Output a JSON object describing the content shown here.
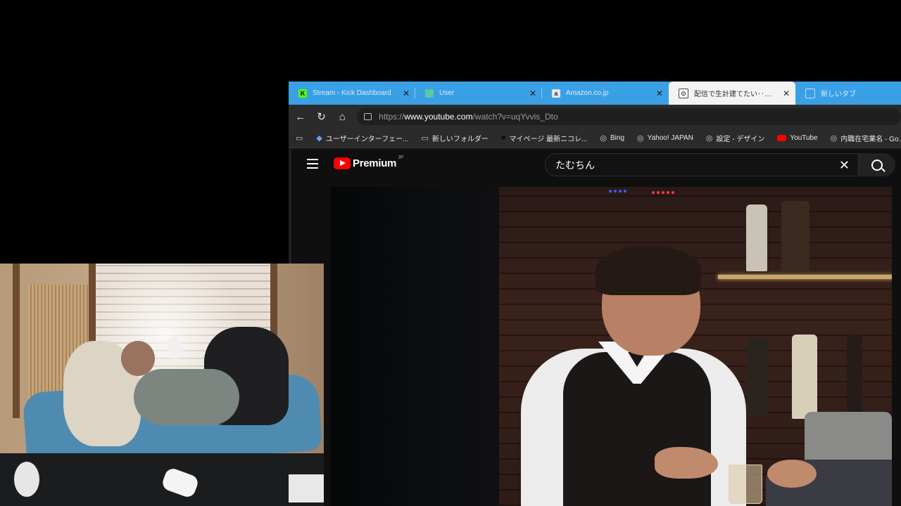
{
  "browser": {
    "tabs": [
      {
        "label": "Stream - Kick Dashboard",
        "icon": "kick-icon",
        "icon_text": "K",
        "color": "#53fc18",
        "active": false
      },
      {
        "label": "User",
        "icon": "user-icon",
        "icon_text": "",
        "color": "#5ac8a0",
        "active": false
      },
      {
        "label": "Amazon.co.jp",
        "icon": "amazon-icon",
        "icon_text": "a",
        "color": "#232f3e",
        "active": false
      },
      {
        "label": "配信で生計建てたい‥わかってんじ",
        "icon": "nico-icon",
        "icon_text": "",
        "color": "#444444",
        "active": true
      },
      {
        "label": "新しいタブ",
        "icon": "new-tab-icon",
        "icon_text": "",
        "color": "#8fc5ee",
        "active": false
      }
    ],
    "address": {
      "prefix": "https://",
      "host": "www.youtube.com",
      "path": "/watch?v=uqYvvis_Dto"
    },
    "bookmarks": [
      {
        "label": "ユーザーインターフェー...",
        "icon": "shield-icon"
      },
      {
        "label": "新しいフォルダー",
        "icon": "folder-icon"
      },
      {
        "label": "マイページ 最新ニコレ...",
        "icon": "nico-icon"
      },
      {
        "label": "Bing",
        "icon": "globe-icon"
      },
      {
        "label": "Yahoo! JAPAN",
        "icon": "globe-icon"
      },
      {
        "label": "設定 - デザイン",
        "icon": "globe-icon"
      },
      {
        "label": "YouTube",
        "icon": "youtube-icon"
      },
      {
        "label": "内職在宅業名 - Go...",
        "icon": "globe-icon"
      }
    ]
  },
  "youtube": {
    "logo_word": "Premium",
    "logo_region": "JP",
    "search_query": "たむちん",
    "clear_glyph": "✕"
  }
}
